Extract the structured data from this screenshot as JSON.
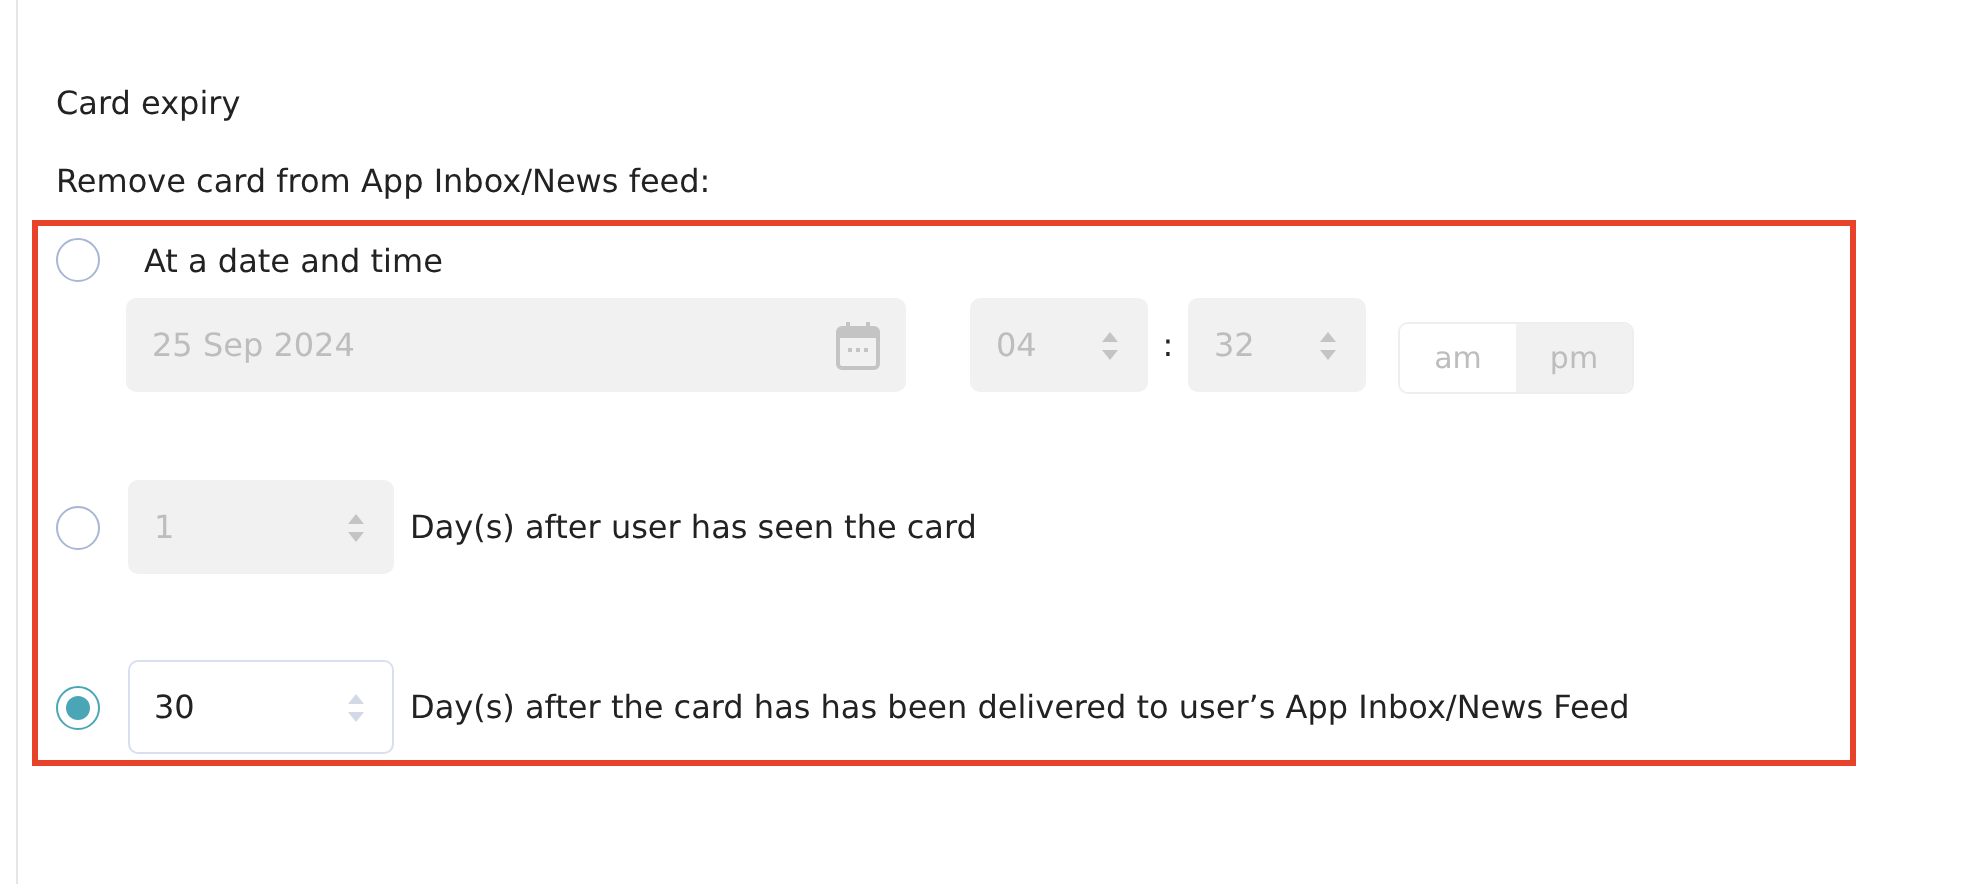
{
  "section": {
    "title": "Card expiry",
    "subtitle": "Remove card from App Inbox/News feed:"
  },
  "options": [
    {
      "kind": "datetime",
      "selected": false,
      "label": "At a date and time",
      "date": "25 Sep 2024",
      "hour": "04",
      "separator": ":",
      "minute": "32",
      "disabled": true,
      "meridiem": [
        {
          "label": "am",
          "selected": true
        },
        {
          "label": "pm",
          "selected": false
        }
      ]
    },
    {
      "kind": "days",
      "selected": false,
      "value": "1",
      "disabled": true,
      "label": "Day(s) after user has seen the card"
    },
    {
      "kind": "days",
      "selected": true,
      "value": "30",
      "disabled": false,
      "label": "Day(s) after the card has has been delivered to user’s App Inbox/News Feed"
    }
  ]
}
